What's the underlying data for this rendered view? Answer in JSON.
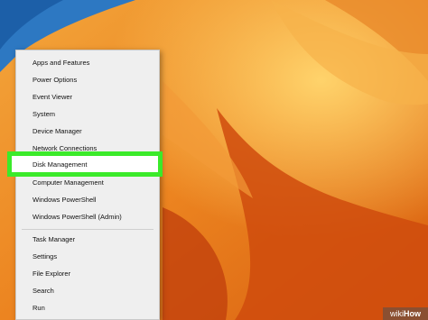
{
  "menu": {
    "items_group1": [
      "Apps and Features",
      "Power Options",
      "Event Viewer",
      "System",
      "Device Manager",
      "Network Connections"
    ],
    "highlighted": "Disk Management",
    "items_group2": [
      "Computer Management",
      "Windows PowerShell",
      "Windows PowerShell (Admin)"
    ],
    "items_group3": [
      "Task Manager",
      "Settings",
      "File Explorer",
      "Search",
      "Run"
    ]
  },
  "watermark": {
    "prefix": "wiki",
    "suffix": "How"
  },
  "colors": {
    "highlight_border": "#3bea2a",
    "menu_bg": "#efefef",
    "desktop_base": "#e8741a"
  }
}
